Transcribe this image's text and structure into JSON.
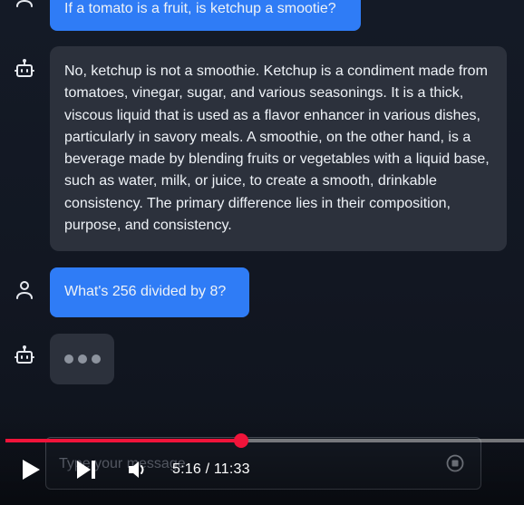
{
  "messages": [
    {
      "role": "user",
      "text": "If a tomato is a fruit, is ketchup a smootie?"
    },
    {
      "role": "assistant",
      "text": "No, ketchup is not a smoothie. Ketchup is a condiment made from tomatoes, vinegar, sugar, and various seasonings. It is a thick, viscous liquid that is used as a flavor enhancer in various dishes, particularly in savory meals. A smoothie, on the other hand, is a beverage made by blending fruits or vegetables with a liquid base, such as water, milk, or juice, to create a smooth, drinkable consistency. The primary difference lies in their composition, purpose, and consistency."
    },
    {
      "role": "user",
      "text": "What's 256 divided by 8?"
    },
    {
      "role": "assistant",
      "state": "typing"
    }
  ],
  "input": {
    "placeholder": "Type your message"
  },
  "video": {
    "time_display": "5:16 / 11:33",
    "progress": 0.455,
    "colors": {
      "progress": "#f0143a",
      "track": "#c8c8c8"
    }
  },
  "colors": {
    "user_bubble": "#2f7cf6",
    "bot_bubble": "#2c313c",
    "background": "#121722"
  },
  "icons": {
    "user": "user-icon",
    "bot": "robot-icon",
    "stop": "stop-circle-icon",
    "play": "play-icon",
    "next": "next-icon",
    "volume": "volume-icon"
  }
}
